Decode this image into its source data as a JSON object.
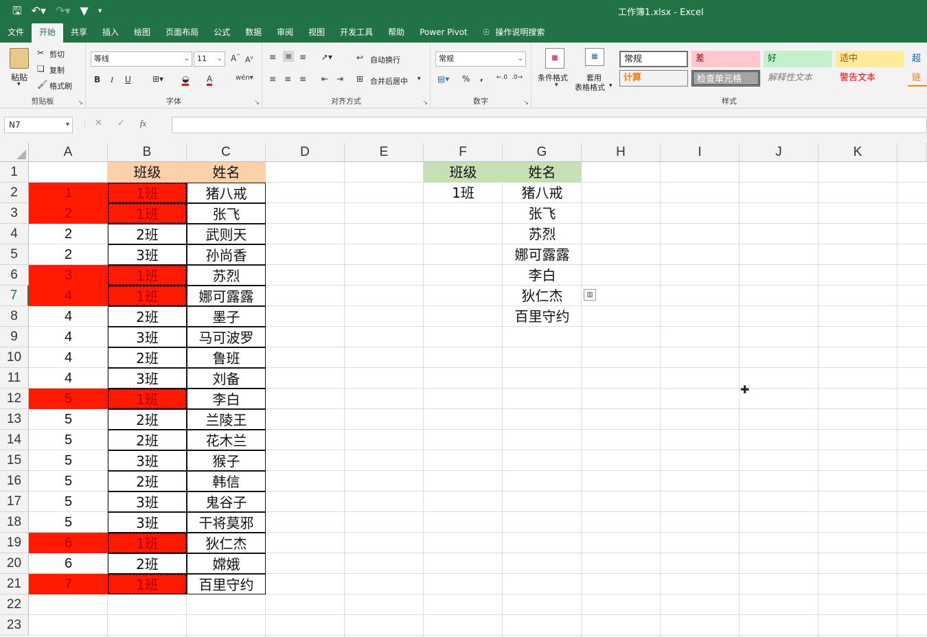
{
  "window": {
    "title": "工作簿1.xlsx  -  Excel"
  },
  "qat": {
    "save_icon": "save-icon",
    "undo_icon": "undo-icon",
    "redo_icon": "redo-icon",
    "filter_icon": "filter-icon"
  },
  "tabs": [
    "文件",
    "开始",
    "共享",
    "插入",
    "绘图",
    "页面布局",
    "公式",
    "数据",
    "审阅",
    "视图",
    "开发工具",
    "帮助",
    "Power Pivot",
    "操作说明搜索"
  ],
  "active_tab": "开始",
  "ribbon": {
    "clipboard": {
      "paste": "粘贴",
      "cut": "剪切",
      "copy": "复制",
      "format_painter": "格式刷",
      "label": "剪贴板"
    },
    "font": {
      "name": "等线",
      "size": "11",
      "bold": "B",
      "italic": "I",
      "underline": "U",
      "label": "字体"
    },
    "alignment": {
      "wrap": "自动换行",
      "merge": "合并后居中",
      "label": "对齐方式"
    },
    "number": {
      "format": "常规",
      "percent": "%",
      "comma": ",",
      "label": "数字"
    },
    "styles": {
      "conditional": "条件格式",
      "table_line1": "套用",
      "table_line2": "表格格式",
      "label": "样式",
      "cells": [
        "常规",
        "差",
        "好",
        "适中",
        "超链",
        "计算",
        "检查单元格",
        "解释性文本",
        "警告文本",
        "链接"
      ]
    }
  },
  "formula_bar": {
    "name_box": "N7",
    "fx": "fx",
    "value": ""
  },
  "columns": [
    "A",
    "B",
    "C",
    "D",
    "E",
    "F",
    "G",
    "H",
    "I",
    "J",
    "K"
  ],
  "rows": [
    "1",
    "2",
    "3",
    "4",
    "5",
    "6",
    "7",
    "8",
    "9",
    "10",
    "11",
    "12",
    "13",
    "14",
    "15",
    "16",
    "17",
    "18",
    "19",
    "20",
    "21",
    "22",
    "23"
  ],
  "sheet": {
    "header": {
      "class": "班级",
      "name": "姓名"
    },
    "data": [
      {
        "a": "1",
        "b": "1班",
        "c": "猪八戒",
        "hl": true
      },
      {
        "a": "2",
        "b": "1班",
        "c": "张飞",
        "hl": true
      },
      {
        "a": "2",
        "b": "2班",
        "c": "武则天",
        "hl": false
      },
      {
        "a": "2",
        "b": "3班",
        "c": "孙尚香",
        "hl": false
      },
      {
        "a": "3",
        "b": "1班",
        "c": "苏烈",
        "hl": true
      },
      {
        "a": "4",
        "b": "1班",
        "c": "娜可露露",
        "hl": true
      },
      {
        "a": "4",
        "b": "2班",
        "c": "墨子",
        "hl": false
      },
      {
        "a": "4",
        "b": "3班",
        "c": "马可波罗",
        "hl": false
      },
      {
        "a": "4",
        "b": "2班",
        "c": "鲁班",
        "hl": false
      },
      {
        "a": "4",
        "b": "3班",
        "c": "刘备",
        "hl": false
      },
      {
        "a": "5",
        "b": "1班",
        "c": "李白",
        "hl": true
      },
      {
        "a": "5",
        "b": "2班",
        "c": "兰陵王",
        "hl": false
      },
      {
        "a": "5",
        "b": "2班",
        "c": "花木兰",
        "hl": false
      },
      {
        "a": "5",
        "b": "3班",
        "c": "猴子",
        "hl": false
      },
      {
        "a": "5",
        "b": "2班",
        "c": "韩信",
        "hl": false
      },
      {
        "a": "5",
        "b": "3班",
        "c": "鬼谷子",
        "hl": false
      },
      {
        "a": "5",
        "b": "3班",
        "c": "干将莫邪",
        "hl": false
      },
      {
        "a": "6",
        "b": "1班",
        "c": "狄仁杰",
        "hl": true
      },
      {
        "a": "6",
        "b": "2班",
        "c": "嫦娥",
        "hl": false
      },
      {
        "a": "7",
        "b": "1班",
        "c": "百里守约",
        "hl": true
      }
    ],
    "result": {
      "class": "1班",
      "names": [
        "猪八戒",
        "张飞",
        "苏烈",
        "娜可露露",
        "李白",
        "狄仁杰",
        "百里守约"
      ]
    }
  },
  "colors": {
    "accent": "#217346",
    "highlight_red": "#ff1a00",
    "header_orange": "#fcd0a8",
    "header_green": "#c6e0b4"
  }
}
